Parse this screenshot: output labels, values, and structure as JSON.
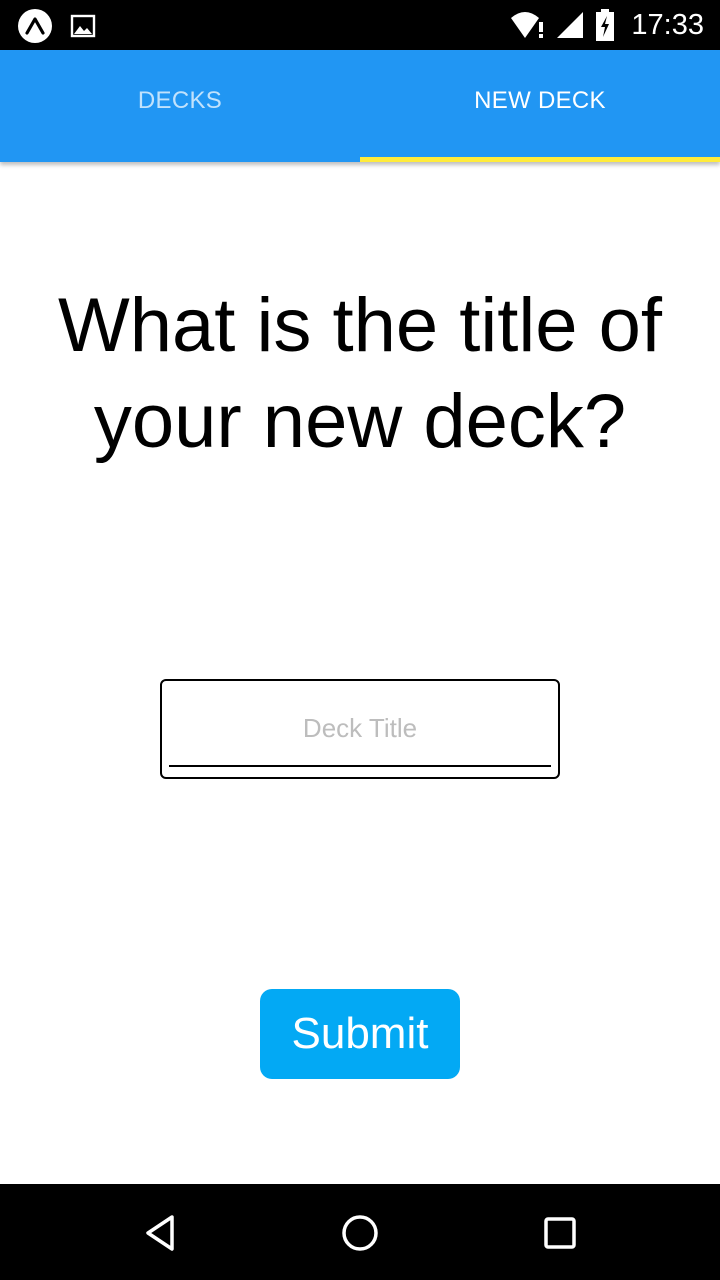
{
  "status_bar": {
    "time": "17:33",
    "icons": [
      "expo-icon",
      "image-icon",
      "wifi-icon",
      "signal-icon",
      "battery-charging-icon"
    ]
  },
  "tabs": [
    {
      "label": "DECKS",
      "active": false
    },
    {
      "label": "NEW DECK",
      "active": true
    }
  ],
  "colors": {
    "tab_bar": "#2196f3",
    "tab_indicator": "#ffeb3b",
    "submit_button": "#03a9f4"
  },
  "form": {
    "heading": "What is the title of your new deck?",
    "title_input": {
      "value": "",
      "placeholder": "Deck Title"
    },
    "submit_label": "Submit"
  },
  "nav_bar": {
    "buttons": [
      "back-icon",
      "home-icon",
      "recents-icon"
    ]
  }
}
